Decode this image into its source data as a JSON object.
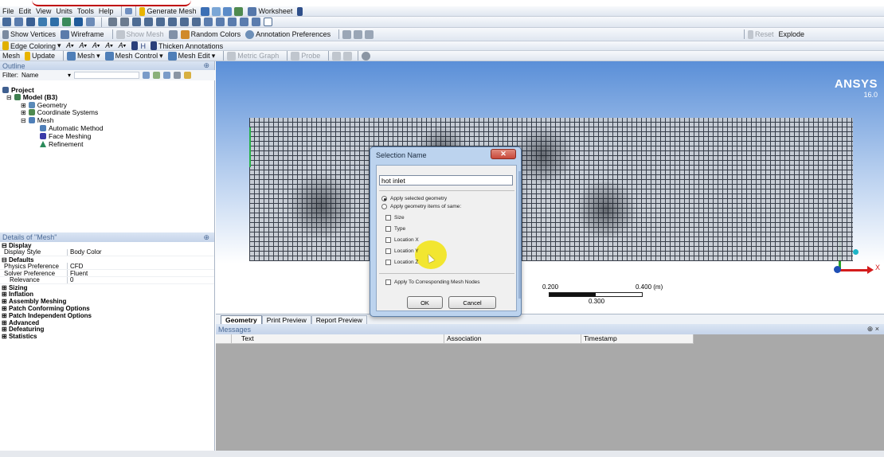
{
  "menu": {
    "items": [
      "File",
      "Edit",
      "View",
      "Units",
      "Tools",
      "Help"
    ],
    "generate_mesh": "Generate Mesh",
    "worksheet": "Worksheet"
  },
  "toolbar3": {
    "show_vertices": "Show Vertices",
    "wireframe": "Wireframe",
    "show_mesh": "Show Mesh",
    "random_colors": "Random Colors",
    "annotation_preferences": "Annotation Preferences",
    "reset": "Reset",
    "explode": "Explode"
  },
  "toolbar4": {
    "edge_coloring": "Edge Coloring",
    "thicken_annotations": "Thicken Annotations"
  },
  "toolbar5": {
    "mesh": "Mesh",
    "update": "Update",
    "mesh_menu": "Mesh",
    "mesh_control": "Mesh Control",
    "mesh_edit": "Mesh Edit",
    "metric_graph": "Metric Graph",
    "probe": "Probe"
  },
  "outline": {
    "title": "Outline",
    "pin": "∙",
    "filter_label": "Filter:",
    "filter_value": "Name",
    "tree": [
      {
        "label": "Project",
        "bold": true
      },
      {
        "label": "Model (B3)",
        "bold": true
      },
      {
        "label": "Geometry"
      },
      {
        "label": "Coordinate Systems"
      },
      {
        "label": "Mesh"
      },
      {
        "label": "Automatic Method"
      },
      {
        "label": "Face Meshing"
      },
      {
        "label": "Refinement"
      }
    ]
  },
  "details": {
    "title": "Details of \"Mesh\"",
    "display_group": "Display",
    "display_style_key": "Display Style",
    "display_style_val": "Body Color",
    "defaults_group": "Defaults",
    "physics_key": "Physics Preference",
    "physics_val": "CFD",
    "solver_key": "Solver Preference",
    "solver_val": "Fluent",
    "relevance_key": "Relevance",
    "relevance_val": "0",
    "groups": [
      "Sizing",
      "Inflation",
      "Assembly Meshing",
      "Patch Conforming Options",
      "Patch Independent Options",
      "Advanced",
      "Defeaturing",
      "Statistics"
    ]
  },
  "viewport": {
    "brand": "ANSYS",
    "version": "16.0",
    "scale_a": "0.200",
    "scale_b": "0.400 (m)",
    "scale_c": "0.300",
    "axis_x": "X"
  },
  "tabs": [
    "Geometry",
    "Print Preview",
    "Report Preview"
  ],
  "messages": {
    "title": "Messages",
    "columns": [
      "Text",
      "Association",
      "Timestamp"
    ]
  },
  "dialog": {
    "title": "Selection Name",
    "name_value": "hot inlet",
    "apply_selected": "Apply selected geometry",
    "apply_items": "Apply geometry items of same:",
    "options": [
      "Size",
      "Type",
      "Location X",
      "Location Y",
      "Location Z"
    ],
    "corresponding": "Apply To Corresponding Mesh Nodes",
    "ok": "OK",
    "cancel": "Cancel"
  },
  "colors": {
    "accent_blue": "#4b6a96",
    "viewport_top": "#5a8fd8",
    "viewport_bottom": "#ffffff",
    "cursor_highlight": "#f2e300",
    "dialog_close": "#c9483a"
  }
}
